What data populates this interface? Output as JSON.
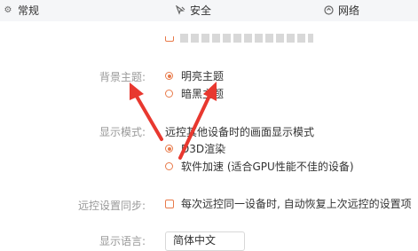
{
  "tabs": [
    {
      "label": "常规",
      "icon": "gear-icon"
    },
    {
      "label": "安全",
      "icon": "shield-icon"
    },
    {
      "label": "网络",
      "icon": "network-icon"
    }
  ],
  "top_partial_option": "",
  "theme": {
    "label": "背景主题:",
    "options": [
      "明亮主题",
      "暗黑主题"
    ],
    "selected": 0
  },
  "display_mode": {
    "label": "显示模式:",
    "description": "远控其他设备时的画面显示模式",
    "options": [
      "D3D渲染",
      "软件加速 (适合GPU性能不佳的设备)"
    ],
    "selected": 0
  },
  "sync": {
    "label": "远控设置同步:",
    "text": "每次远控同一设备时, 自动恢复上次远控的设置项"
  },
  "language": {
    "label": "显示语言:",
    "value": "简体中文"
  },
  "colors": {
    "accent": "#e87a4a",
    "arrow": "#e8382f",
    "label": "#999999",
    "tabbar": "#f5f6f8"
  }
}
